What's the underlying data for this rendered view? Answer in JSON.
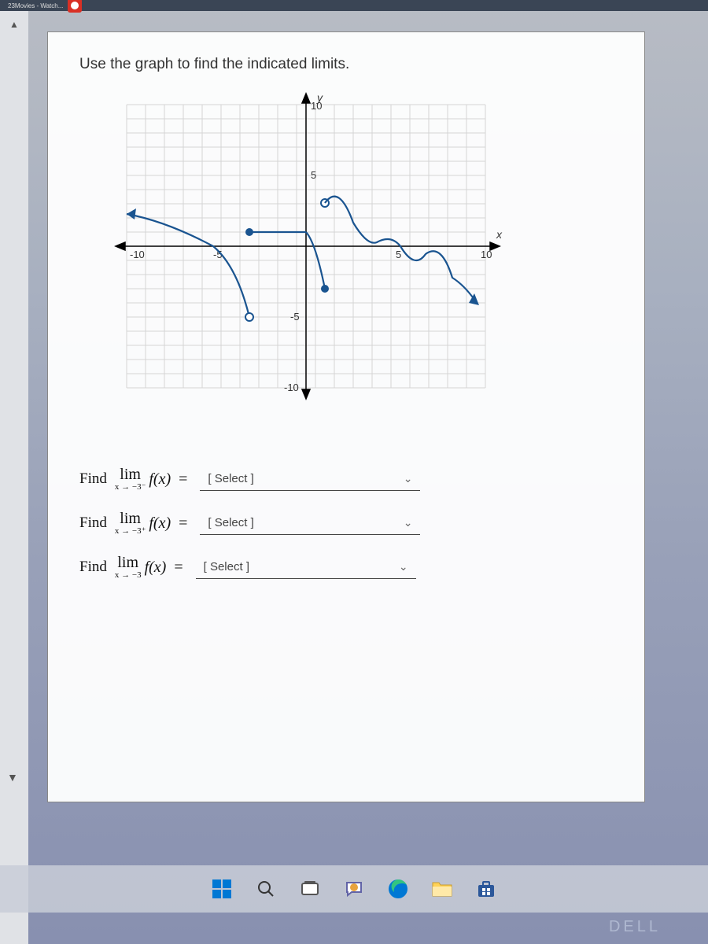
{
  "top_bar": {
    "bookmark": "23Movies - Watch..."
  },
  "question": {
    "prompt": "Use the graph to find the indicated limits."
  },
  "chart_data": {
    "type": "line",
    "title": "",
    "xlabel": "x",
    "ylabel": "y",
    "xlim": [
      -10,
      10
    ],
    "ylim": [
      -10,
      10
    ],
    "xticks": [
      -10,
      -5,
      5,
      10
    ],
    "yticks": [
      -10,
      -5,
      5,
      10
    ],
    "series": [
      {
        "name": "left-branch",
        "x": [
          -10,
          -9,
          -7,
          -5,
          -4,
          -3
        ],
        "y": [
          2.3,
          2,
          1.3,
          0,
          -1.5,
          -5
        ],
        "left_arrow": true,
        "right_open_at": {
          "x": -3,
          "y": -5
        }
      },
      {
        "name": "right-branch",
        "x": [
          -3,
          0,
          1,
          2,
          3,
          4,
          5,
          6,
          7,
          8,
          9,
          10
        ],
        "y": [
          1,
          1,
          -1,
          -3,
          1.7,
          0.3,
          1,
          -1.5,
          -0.5,
          -2,
          -2.2,
          -4
        ],
        "left_closed_at": {
          "x": -3,
          "y": 1
        },
        "right_arrow": true,
        "right_open_at": {
          "x": 1,
          "y": -3
        }
      },
      {
        "name": "right-branch-part2-start",
        "closed_at": {
          "x": 1,
          "y": -3
        }
      }
    ]
  },
  "limits": [
    {
      "prefix": "Find",
      "approach": "x → −3⁻",
      "placeholder": "[ Select ]"
    },
    {
      "prefix": "Find",
      "approach": "x → −3⁺",
      "placeholder": "[ Select ]"
    },
    {
      "prefix": "Find",
      "approach": "x → −3",
      "placeholder": "[ Select ]"
    }
  ],
  "taskbar": {
    "icons": [
      "windows",
      "search",
      "task-view",
      "chat",
      "edge",
      "file-explorer",
      "store"
    ]
  },
  "brand": "DELL"
}
